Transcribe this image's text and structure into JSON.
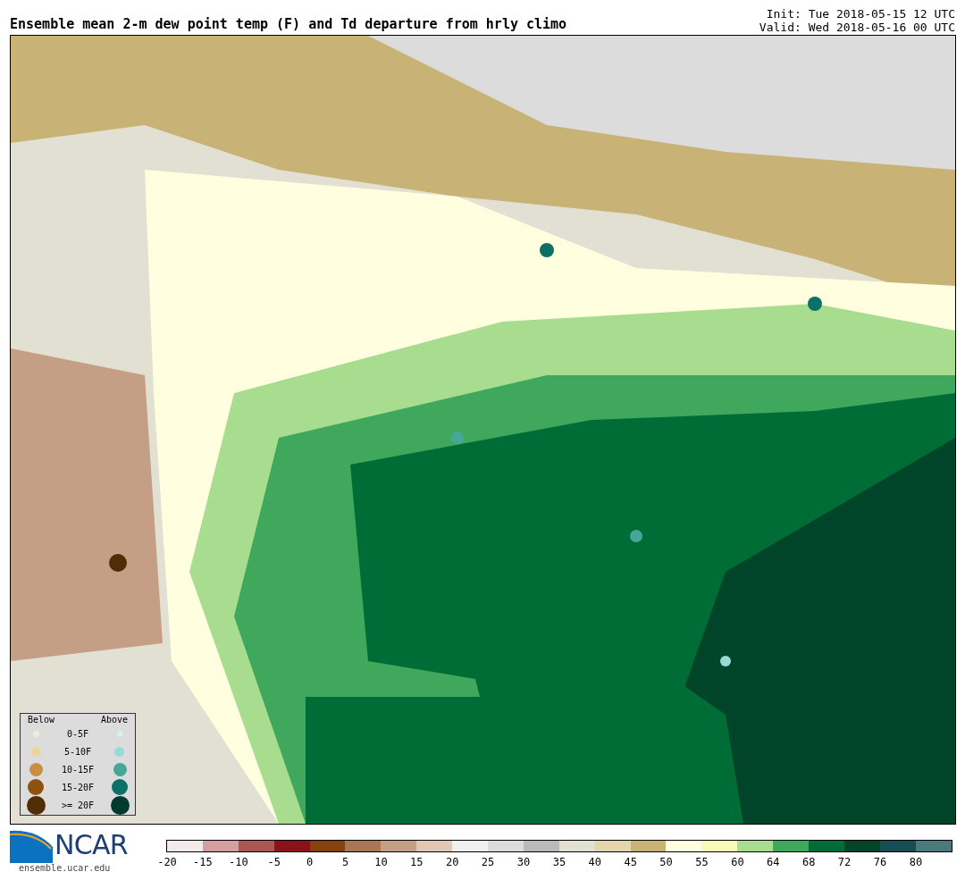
{
  "title": "Ensemble mean 2-m dew point temp (F) and Td departure from hrly climo",
  "init": "Init: Tue 2018-05-15 12 UTC",
  "valid": "Valid: Wed 2018-05-16 00 UTC",
  "legend": {
    "below_heading": "Below",
    "above_heading": "Above",
    "rows": [
      {
        "label": "0-5F",
        "below": {
          "color": "#f3ead6"
        },
        "above": {
          "color": "#d8efee"
        }
      },
      {
        "label": "5-10F",
        "below": {
          "color": "#ebd49e"
        },
        "above": {
          "color": "#96dcd4"
        }
      },
      {
        "label": "10-15F",
        "below": {
          "color": "#c98f40"
        },
        "above": {
          "color": "#46a697"
        }
      },
      {
        "label": "15-20F",
        "below": {
          "color": "#8f530f"
        },
        "above": {
          "color": "#0b7066"
        }
      },
      {
        "label": ">= 20F",
        "below": {
          "color": "#4f2e06"
        },
        "above": {
          "color": "#023a30"
        }
      }
    ]
  },
  "logo": {
    "text": "NCAR",
    "url": "ensemble.ucar.edu"
  },
  "colorbar": {
    "swatches": [
      {
        "color": "#f3ebe9"
      },
      {
        "color": "#d4a09f"
      },
      {
        "color": "#ab5555"
      },
      {
        "color": "#8a131b"
      },
      {
        "color": "#86420e"
      },
      {
        "color": "#a97753"
      },
      {
        "color": "#c59f85"
      },
      {
        "color": "#e0c8b5"
      },
      {
        "color": "#f0f0f0"
      },
      {
        "color": "#dcdcdc"
      },
      {
        "color": "#bababa"
      },
      {
        "color": "#e1e0d2"
      },
      {
        "color": "#e4d6ac"
      },
      {
        "color": "#c9b276"
      },
      {
        "color": "#ffffe0"
      },
      {
        "color": "#f6fbb8"
      },
      {
        "color": "#a8dc8f"
      },
      {
        "color": "#40a85c"
      },
      {
        "color": "#006d36"
      },
      {
        "color": "#00452a"
      },
      {
        "color": "#174e54"
      },
      {
        "color": "#4b7a7a"
      }
    ],
    "ticks": [
      "-20",
      "-15",
      "-10",
      "-5",
      "0",
      "5",
      "10",
      "15",
      "20",
      "25",
      "30",
      "35",
      "40",
      "45",
      "50",
      "55",
      "60",
      "64",
      "68",
      "72",
      "76",
      "80"
    ]
  }
}
